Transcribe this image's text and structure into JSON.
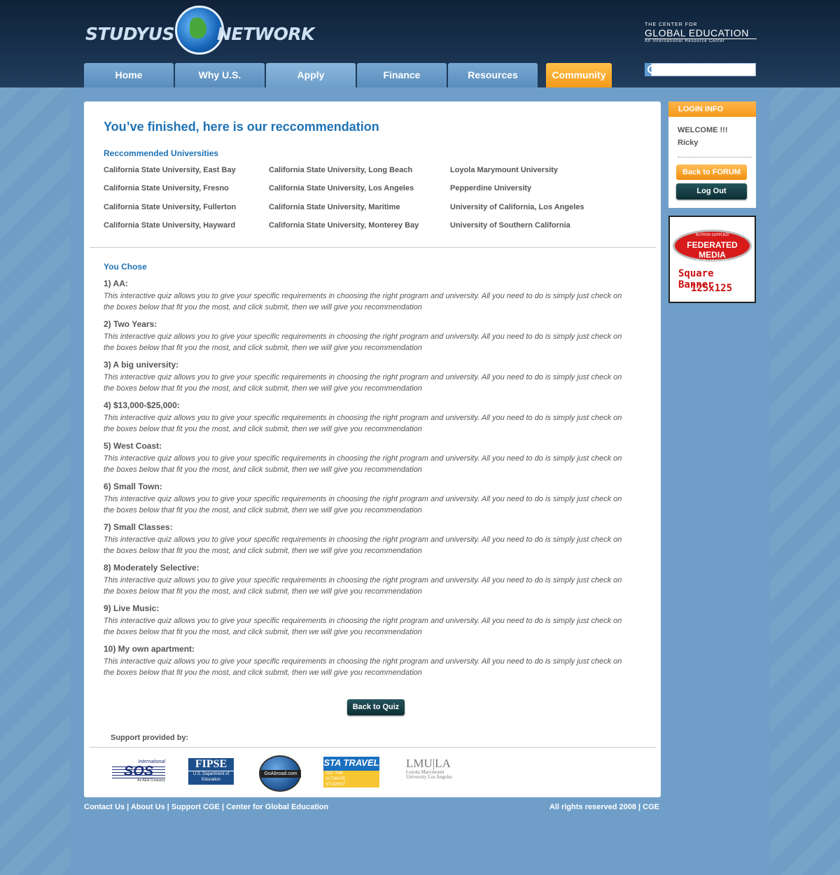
{
  "header": {
    "logo_left": "STUDYUS",
    "logo_right": "NETWORK",
    "cge_top": "THE CENTER FOR",
    "cge_main": "GLOBAL EDUCATION",
    "cge_sub": "An International Resource Center",
    "search_placeholder": ""
  },
  "nav": {
    "tabs": [
      "Home",
      "Why U.S.",
      "Apply",
      "Finance",
      "Resources",
      "Community"
    ],
    "active": "Apply",
    "accent_color": "#f59a1a"
  },
  "main": {
    "title": "You’ve finished, here is our reccommendation",
    "recommended_heading": "Reccommended Universities",
    "universities": [
      [
        "California State University, East Bay",
        "California State University, Long Beach",
        "Loyola Marymount University"
      ],
      [
        "California State University, Fresno",
        "California State University, Los Angeles",
        "Pepperdine University"
      ],
      [
        "California State University, Fullerton",
        "California State University, Maritime",
        "University of California, Los Angeles"
      ],
      [
        "California State University, Hayward",
        "California State University, Monterey Bay",
        "University of Southern California"
      ]
    ],
    "you_chose_heading": "You Chose",
    "choices": [
      {
        "title": "1) AA:",
        "desc": "This interactive quiz allows you to give your specific requirements in choosing the right program and university. All you need to do is simply just check on the boxes below that fit you the most, and click submit, then we will give you recommendation"
      },
      {
        "title": "2) Two Years:",
        "desc": "This interactive quiz allows you to give your specific requirements in choosing the right program and university. All you need to do is simply just check on the boxes below that fit you the most, and click submit, then we will give you recommendation"
      },
      {
        "title": "3) A big university:",
        "desc": "This interactive quiz allows you to give your specific requirements in choosing the right program and university. All you need to do is simply just check on the boxes below that fit you the most, and click submit, then we will give you recommendation"
      },
      {
        "title": "4) $13,000-$25,000:",
        "desc": "This interactive quiz allows you to give your specific requirements in choosing the right program and university. All you need to do is simply just check on the boxes below that fit you the most, and click submit, then we will give you recommendation"
      },
      {
        "title": "5) West Coast:",
        "desc": "This interactive quiz allows you to give your specific requirements in choosing the right program and university. All you need to do is simply just check on the boxes below that fit you the most, and click submit, then we will give you recommendation"
      },
      {
        "title": "6) Small Town:",
        "desc": "This interactive quiz allows you to give your specific requirements in choosing the right program and university. All you need to do is simply just check on the boxes below that fit you the most, and click submit, then we will give you recommendation"
      },
      {
        "title": "7) Small Classes:",
        "desc": "This interactive quiz allows you to give your specific requirements in choosing the right program and university. All you need to do is simply just check on the boxes below that fit you the most, and click submit, then we will give you recommendation"
      },
      {
        "title": "8) Moderately Selective:",
        "desc": "This interactive quiz allows you to give your specific requirements in choosing the right program and university. All you need to do is simply just check on the boxes below that fit you the most, and click submit, then we will give you recommendation"
      },
      {
        "title": "9) Live Music:",
        "desc": "This interactive quiz allows you to give your specific requirements in choosing the right program and university. All you need to do is simply just check on the boxes below that fit you the most, and click submit, then we will give you recommendation"
      },
      {
        "title": "10) My own apartment:",
        "desc": "This interactive quiz allows you to give your specific requirements in choosing the right program and university. All you need to do is simply just check on the boxes below that fit you the most, and click submit, then we will give you recommendation"
      }
    ],
    "back_to_quiz_label": "Back to Quiz",
    "support_label": "Support provided by:",
    "sponsors": {
      "sos_top": "International",
      "sos_main": "SOS",
      "sos_sub": "An AEA Company",
      "fipse_main": "FIPSE",
      "fipse_sub": "U.S. Department of Education",
      "goabroad": "GoAbroad.com",
      "sta_main": "STA TRAVEL",
      "sta_sub": "ISIC THE ULTIMATE STUDENT TRAVEL CARD",
      "lmu_main": "LMU|LA",
      "lmu_sub": "Loyola Marymount University Los Angeles"
    }
  },
  "sidebar": {
    "login_heading": "LOGIN INFO",
    "welcome": "WELCOME !!!",
    "username": "Ricky",
    "back_forum_label": "Back to FORUM",
    "logout_label": "Log Out",
    "banner": {
      "top_text": "AUTHOR SUPPLIED",
      "name": "FEDERATED MEDIA",
      "pub": "PUBLISHING",
      "line1": "Square Banner",
      "line2": "125x125"
    }
  },
  "footer": {
    "links": "Contact Us | About Us | Support CGE | Center for Global Education",
    "copyright": "All rights reserved 2008 | CGE"
  }
}
